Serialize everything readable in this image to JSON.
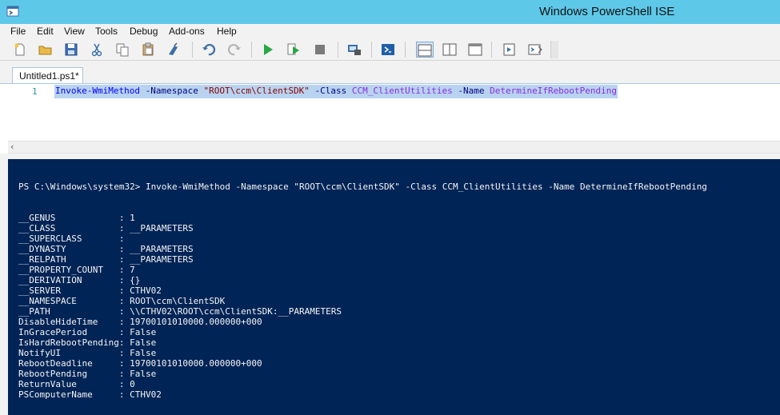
{
  "window": {
    "title": "Windows PowerShell ISE"
  },
  "menu": [
    "File",
    "Edit",
    "View",
    "Tools",
    "Debug",
    "Add-ons",
    "Help"
  ],
  "toolbar": {
    "icons": [
      "new-icon",
      "open-icon",
      "save-icon",
      "cut-icon",
      "copy-icon",
      "paste-icon",
      "clear-icon",
      "undo-icon",
      "redo-icon",
      "run-icon",
      "run-selection-icon",
      "stop-icon",
      "remote-icon",
      "powershell-icon",
      "layout-top-icon",
      "layout-right-icon",
      "layout-max-icon",
      "script-pane-icon",
      "show-command-icon"
    ]
  },
  "tab": {
    "label": "Untitled1.ps1*"
  },
  "editor": {
    "line_number": "1",
    "tokens": [
      {
        "text": "Invoke-WmiMethod",
        "kind": "cmd"
      },
      {
        "text": " -Namespace ",
        "kind": "param"
      },
      {
        "text": "\"ROOT\\ccm\\ClientSDK\"",
        "kind": "str"
      },
      {
        "text": " -Class ",
        "kind": "param"
      },
      {
        "text": "CCM_ClientUtilities",
        "kind": "type"
      },
      {
        "text": " -Name ",
        "kind": "param"
      },
      {
        "text": "DetermineIfRebootPending",
        "kind": "type"
      }
    ]
  },
  "console": {
    "prompt": "PS C:\\Windows\\system32> Invoke-WmiMethod -Namespace \"ROOT\\ccm\\ClientSDK\" -Class CCM_ClientUtilities -Name DetermineIfRebootPending",
    "rows": [
      {
        "key": "__GENUS",
        "value": "1"
      },
      {
        "key": "__CLASS",
        "value": "__PARAMETERS"
      },
      {
        "key": "__SUPERCLASS",
        "value": ""
      },
      {
        "key": "__DYNASTY",
        "value": "__PARAMETERS"
      },
      {
        "key": "__RELPATH",
        "value": "__PARAMETERS"
      },
      {
        "key": "__PROPERTY_COUNT",
        "value": "7"
      },
      {
        "key": "__DERIVATION",
        "value": "{}"
      },
      {
        "key": "__SERVER",
        "value": "CTHV02"
      },
      {
        "key": "__NAMESPACE",
        "value": "ROOT\\ccm\\ClientSDK"
      },
      {
        "key": "__PATH",
        "value": "\\\\CTHV02\\ROOT\\ccm\\ClientSDK:__PARAMETERS"
      },
      {
        "key": "DisableHideTime",
        "value": "19700101010000.000000+000"
      },
      {
        "key": "InGracePeriod",
        "value": "False"
      },
      {
        "key": "IsHardRebootPending",
        "value": "False"
      },
      {
        "key": "NotifyUI",
        "value": "False"
      },
      {
        "key": "RebootDeadline",
        "value": "19700101010000.000000+000"
      },
      {
        "key": "RebootPending",
        "value": "False"
      },
      {
        "key": "ReturnValue",
        "value": "0"
      },
      {
        "key": "PSComputerName",
        "value": "CTHV02"
      }
    ]
  },
  "colors": {
    "titlebar": "#5ec8e8",
    "console_bg": "#012456",
    "selection": "#b8d3f0"
  }
}
